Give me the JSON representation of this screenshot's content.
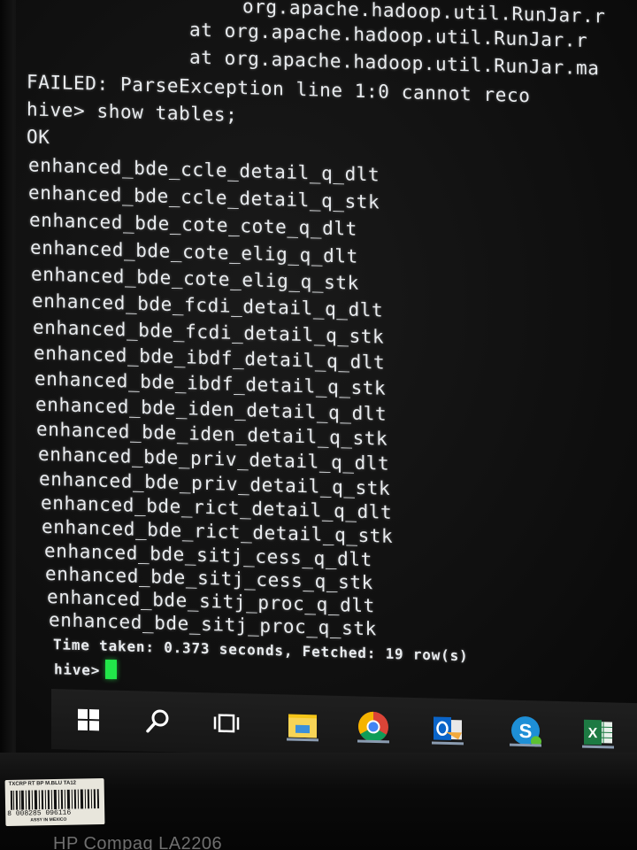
{
  "terminal": {
    "lines": [
      "        org.apache.hadoop.util.RunJar.r",
      "        at org.apache.hadoop.util.RunJar.r",
      "        at org.apache.hadoop.util.RunJar.ma",
      "FAILED: ParseException line 1:0 cannot reco",
      "hive> show tables;",
      "OK",
      "enhanced_bde_ccle_detail_q_dlt",
      "enhanced_bde_ccle_detail_q_stk",
      "enhanced_bde_cote_cote_q_dlt",
      "enhanced_bde_cote_elig_q_dlt",
      "enhanced_bde_cote_elig_q_stk",
      "enhanced_bde_fcdi_detail_q_dlt",
      "enhanced_bde_fcdi_detail_q_stk",
      "enhanced_bde_ibdf_detail_q_dlt",
      "enhanced_bde_ibdf_detail_q_stk",
      "enhanced_bde_iden_detail_q_dlt",
      "enhanced_bde_iden_detail_q_stk",
      "enhanced_bde_priv_detail_q_dlt",
      "enhanced_bde_priv_detail_q_stk",
      "enhanced_bde_rict_detail_q_dlt",
      "enhanced_bde_rict_detail_q_stk",
      "enhanced_bde_sitj_cess_q_dlt",
      "enhanced_bde_sitj_cess_q_stk",
      "enhanced_bde_sitj_proc_q_dlt",
      "enhanced_bde_sitj_proc_q_stk",
      "Time taken: 0.373 seconds, Fetched: 19 row(s)"
    ],
    "prompt": "hive>"
  },
  "taskbar": {
    "icons": [
      "windows-start-icon",
      "search-icon",
      "task-view-icon",
      "file-explorer-icon",
      "chrome-icon",
      "outlook-icon",
      "skype-for-business-icon",
      "excel-icon"
    ]
  },
  "sticker": {
    "top_text": "TXCRP RT BP M.BLU TA12",
    "number": "8 008285 096116",
    "bottom_text": "ASSY IN MEXICO"
  },
  "monitor": {
    "brand": "HP Compaq LA2206"
  },
  "colors": {
    "terminal_text": "#e9ecef",
    "cursor": "#22e64a",
    "background": "#0d0d0d"
  }
}
